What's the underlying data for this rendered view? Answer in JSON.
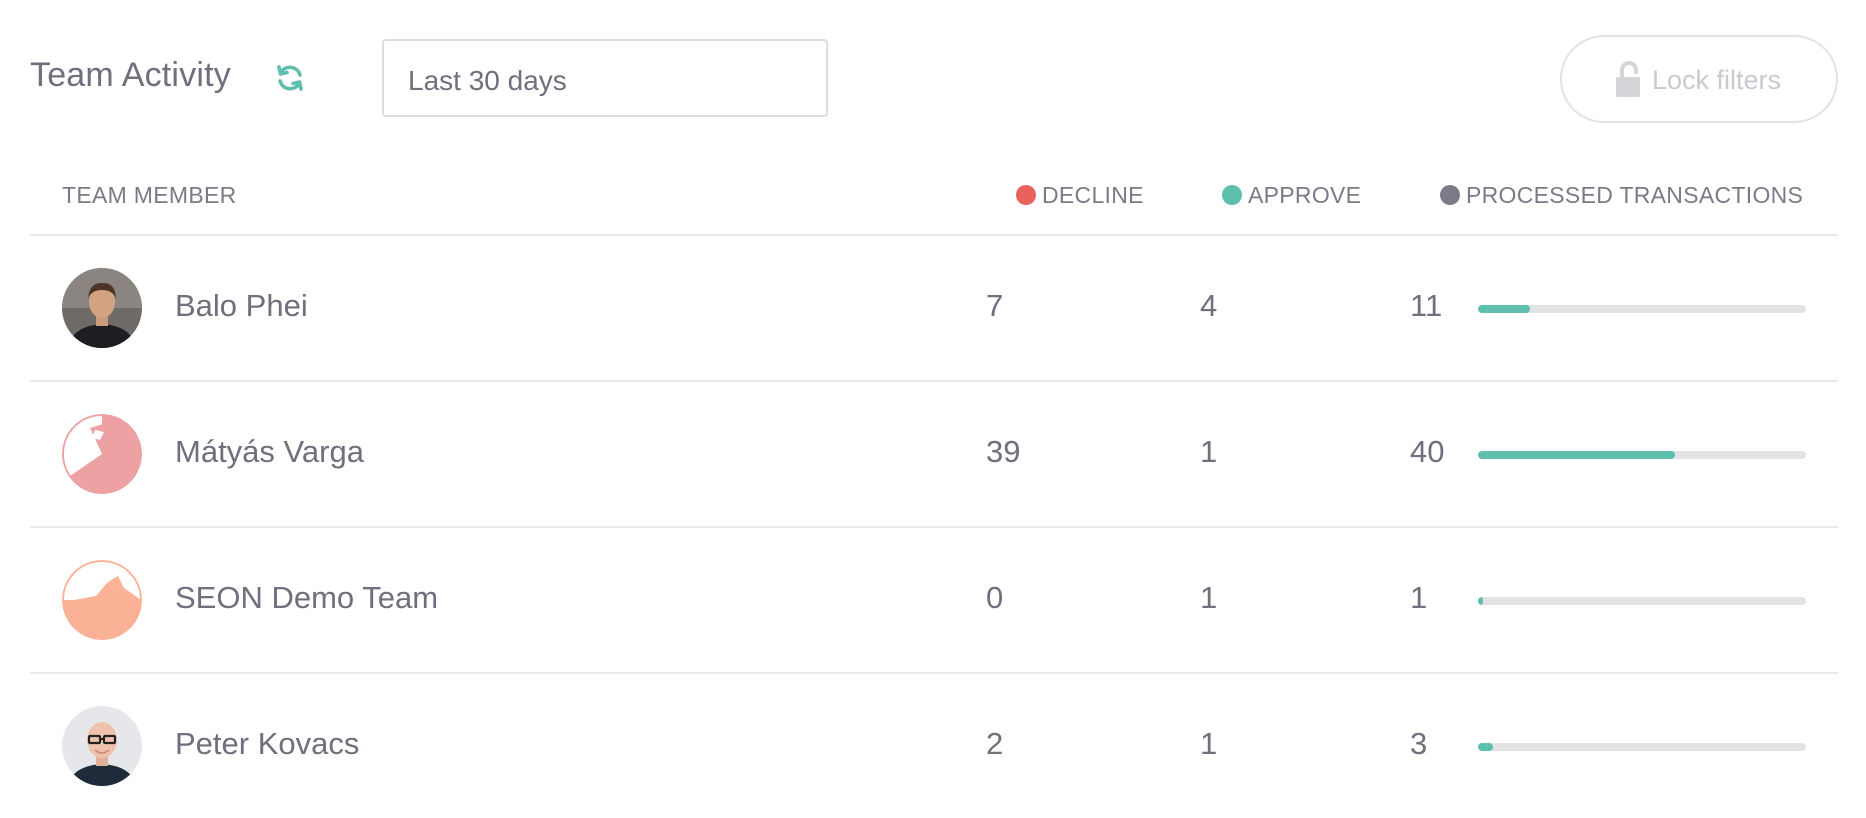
{
  "header": {
    "title": "Team Activity",
    "refresh_icon": "refresh-icon",
    "date_range": {
      "value": "Last 30 days"
    },
    "lock_button": {
      "label": "Lock filters",
      "icon": "unlock-icon"
    }
  },
  "colors": {
    "decline": "#e8615c",
    "approve": "#5fbfae",
    "processed": "#7b7b88",
    "bar_track": "#e3e3e6"
  },
  "table": {
    "columns": {
      "member": "TEAM MEMBER",
      "decline": "DECLINE",
      "approve": "APPROVE",
      "processed": "PROCESSED TRANSACTIONS"
    },
    "rows": [
      {
        "name": "Balo Phei",
        "decline": "7",
        "approve": "4",
        "processed": "11",
        "bar_fraction": 0.16,
        "avatar": "photo-avatar"
      },
      {
        "name": "Mátyás Varga",
        "decline": "39",
        "approve": "1",
        "processed": "40",
        "bar_fraction": 0.6,
        "avatar": "identicon-avatar"
      },
      {
        "name": "SEON Demo Team",
        "decline": "0",
        "approve": "1",
        "processed": "1",
        "bar_fraction": 0.015,
        "avatar": "identicon-avatar"
      },
      {
        "name": "Peter Kovacs",
        "decline": "2",
        "approve": "1",
        "processed": "3",
        "bar_fraction": 0.045,
        "avatar": "photo-avatar"
      }
    ]
  }
}
